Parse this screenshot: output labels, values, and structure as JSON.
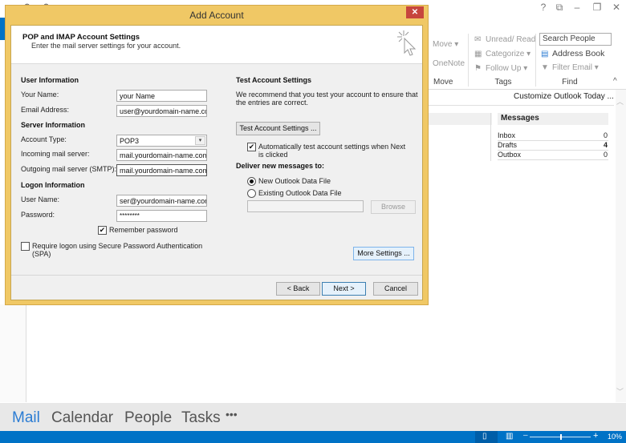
{
  "outlook": {
    "title_controls": {
      "help": "?",
      "restore_ribbon": "⧉",
      "minimize": "–",
      "maximize": "❐",
      "close": "✕"
    },
    "quick_access": {
      "send_receive_icon": "⟳",
      "undo_icon": "↶"
    },
    "ribbon": {
      "move_group": {
        "move": "Move ▾",
        "onenote": "OneNote",
        "label": "Move"
      },
      "tags_group": {
        "unread_read": "Unread/ Read",
        "categorize": "Categorize ▾",
        "follow_up": "Follow Up ▾",
        "label": "Tags"
      },
      "find_group": {
        "search_people_placeholder": "Search People",
        "address_book": "Address Book",
        "filter_email": "Filter Email ▾",
        "label": "Find"
      },
      "collapse": "^"
    },
    "customize_link": "Customize Outlook Today ...",
    "messages": {
      "title": "Messages",
      "rows": [
        {
          "label": "Inbox",
          "count": "0"
        },
        {
          "label": "Drafts",
          "count": "4"
        },
        {
          "label": "Outbox",
          "count": "0"
        }
      ]
    },
    "nav": [
      {
        "label": "Mail",
        "active": true
      },
      {
        "label": "Calendar",
        "active": false
      },
      {
        "label": "People",
        "active": false
      },
      {
        "label": "Tasks",
        "active": false
      },
      {
        "label": "•••",
        "active": false
      }
    ],
    "status_bar": {
      "zoom": "10%",
      "zoom_minus": "–",
      "zoom_plus": "+",
      "normal_view_icon": "▯",
      "reading_view_icon": "▥"
    }
  },
  "dialog": {
    "title": "Add Account",
    "close": "✕",
    "header": {
      "title": "POP and IMAP Account Settings",
      "subtitle": "Enter the mail server settings for your account."
    },
    "user_info": {
      "section": "User Information",
      "name_label": "Your Name:",
      "name_value": "your Name",
      "email_label": "Email Address:",
      "email_value": "user@yourdomain-name.com"
    },
    "server_info": {
      "section": "Server Information",
      "account_type_label": "Account Type:",
      "account_type_value": "POP3",
      "incoming_label": "Incoming mail server:",
      "incoming_value": "mail.yourdomain-name.com",
      "outgoing_label": "Outgoing mail server (SMTP):",
      "outgoing_value": "mail.yourdomain-name.com"
    },
    "logon_info": {
      "section": "Logon Information",
      "username_label": "User Name:",
      "username_value": "ser@yourdomain-name.com",
      "password_label": "Password:",
      "password_value": "********",
      "remember_label": "Remember password",
      "remember_checked": true,
      "spa_label_1": "Require logon using Secure Password Authentication",
      "spa_label_2": "(SPA)",
      "spa_checked": false
    },
    "test": {
      "section": "Test Account Settings",
      "desc_1": "We recommend that you test your account to ensure that",
      "desc_2": "the entries are correct.",
      "button": "Test Account Settings ...",
      "auto_label_1": "Automatically test account settings when Next",
      "auto_label_2": "is clicked",
      "auto_checked": true
    },
    "deliver": {
      "section": "Deliver new messages to:",
      "new_file": "New Outlook Data File",
      "existing_file": "Existing Outlook Data File",
      "selected": "new",
      "path_value": "",
      "browse": "Browse"
    },
    "more_settings": "More Settings ...",
    "buttons": {
      "back": "< Back",
      "next": "Next >",
      "cancel": "Cancel"
    },
    "check_mark": "✔"
  }
}
